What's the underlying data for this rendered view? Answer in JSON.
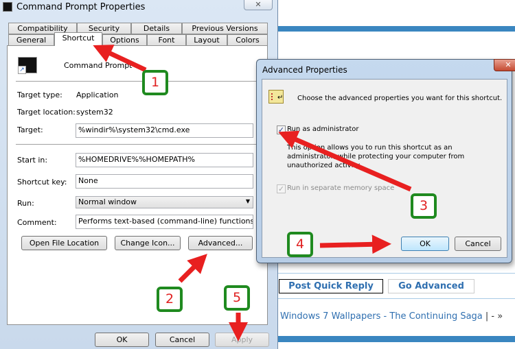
{
  "properties_dialog": {
    "title": "Command Prompt Properties",
    "close_label": "✕",
    "tabs_row1": [
      "Compatibility",
      "Security",
      "Details",
      "Previous Versions"
    ],
    "tabs_row2": [
      "General",
      "Shortcut",
      "Options",
      "Font",
      "Layout",
      "Colors"
    ],
    "selected_tab": "Shortcut",
    "shortcut_name": "Command Prompt",
    "target_type_label": "Target type:",
    "target_type": "Application",
    "target_location_label": "Target location:",
    "target_location": "system32",
    "target_label": "Target:",
    "target": "%windir%\\system32\\cmd.exe",
    "start_in_label": "Start in:",
    "start_in": "%HOMEDRIVE%%HOMEPATH%",
    "shortcut_key_label": "Shortcut key:",
    "shortcut_key": "None",
    "run_label": "Run:",
    "run": "Normal window",
    "comment_label": "Comment:",
    "comment": "Performs text-based (command-line) functions.",
    "open_file_location": "Open File Location",
    "change_icon": "Change Icon...",
    "advanced": "Advanced...",
    "ok": "OK",
    "cancel": "Cancel",
    "apply": "Apply"
  },
  "advanced_dialog": {
    "title": "Advanced Properties",
    "close_label": "✕",
    "prompt": "Choose the advanced properties you want for this shortcut.",
    "run_as_admin": "Run as administrator",
    "run_as_admin_checked": true,
    "description": [
      "This option allows you to run this shortcut as an",
      "administrator, while protecting your computer from",
      "unauthorized activity."
    ],
    "separate_memory": "Run in separate memory space",
    "separate_memory_checked": true,
    "ok": "OK",
    "cancel": "Cancel"
  },
  "web": {
    "post_quick_reply": "Post Quick Reply",
    "go_advanced": "Go Advanced",
    "thread_link": "Windows 7 Wallpapers - The Continuing Saga",
    "trail": "| - »"
  },
  "callouts": [
    "1",
    "2",
    "3",
    "4",
    "5"
  ],
  "colors": {
    "arrow": "#e82020",
    "callout_border": "#1f8a1f",
    "link": "#2f6fb0"
  }
}
